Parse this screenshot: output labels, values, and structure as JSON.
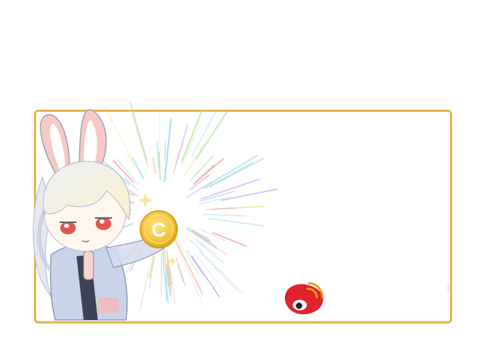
{
  "banner": {
    "frame_color": "#e3b54a",
    "coin_color": "#f2c53a",
    "coin_letter": "C",
    "logo": "weibo-icon",
    "logo_color": "#e0242b",
    "logo_accent": "#f39a22"
  }
}
